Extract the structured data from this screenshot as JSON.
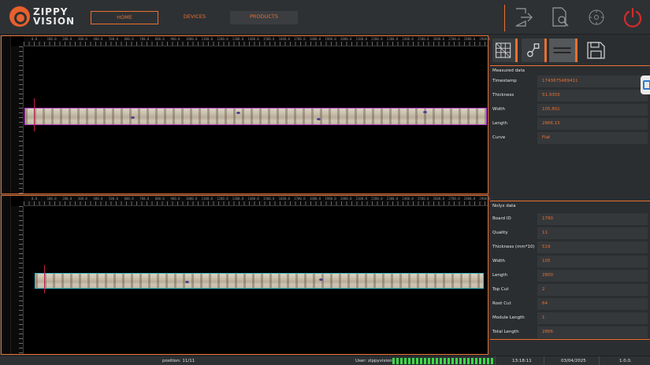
{
  "header": {
    "brand_line1": "ZIPPY",
    "brand_line2": "VISION",
    "nav": {
      "home": "HOME",
      "devices": "DEVICES",
      "products": "PRODUCTS"
    },
    "icons": [
      "exit-icon",
      "report-search-icon",
      "settings-icon",
      "power-icon"
    ],
    "colors": {
      "accent": "#e8702f",
      "power": "#d42b2b"
    }
  },
  "viewer_top": {
    "ruler_labels": [
      "0.0",
      "100.0",
      "200.0",
      "300.0",
      "400.0",
      "500.0",
      "600.0",
      "700.0",
      "800.0",
      "900.0",
      "1000.0",
      "1100.0",
      "1200.0",
      "1300.0",
      "1400.0",
      "1500.0",
      "1600.0",
      "1700.0",
      "1800.0",
      "1900.0",
      "2000.0",
      "2100.0",
      "2200.0",
      "2300.0",
      "2400.0",
      "2500.0",
      "2600.0",
      "2700.0",
      "2800.0",
      "2900.0"
    ]
  },
  "viewer_bottom": {
    "ruler_labels": [
      "0.0",
      "100.0",
      "200.0",
      "300.0",
      "400.0",
      "500.0",
      "600.0",
      "700.0",
      "800.0",
      "900.0",
      "1000.0",
      "1100.0",
      "1200.0",
      "1300.0",
      "1400.0",
      "1500.0",
      "1600.0",
      "1700.0",
      "1800.0",
      "1900.0",
      "2000.0",
      "2100.0",
      "2200.0",
      "2300.0",
      "2400.0",
      "2500.0",
      "2600.0",
      "2700.0",
      "2800.0",
      "2900.0"
    ]
  },
  "measured": {
    "title": "Measured data",
    "rows": [
      {
        "label": "Timestamp",
        "value": "1743675489411"
      },
      {
        "label": "Thickness",
        "value": "51.9355"
      },
      {
        "label": "Width",
        "value": "105.801"
      },
      {
        "label": "Length",
        "value": "2866.15"
      },
      {
        "label": "Curve",
        "value": "Flat"
      }
    ]
  },
  "nolyx": {
    "title": "Nolyx data",
    "rows": [
      {
        "label": "Board ID",
        "value": "1780"
      },
      {
        "label": "Quality",
        "value": "11"
      },
      {
        "label": "Thickness (mm*10)",
        "value": "519"
      },
      {
        "label": "Width",
        "value": "105"
      },
      {
        "label": "Length",
        "value": "2800"
      },
      {
        "label": "Top Cut",
        "value": "2"
      },
      {
        "label": "Root Cut",
        "value": "64"
      },
      {
        "label": "Module Length",
        "value": "1"
      },
      {
        "label": "Total Length",
        "value": "2866"
      }
    ]
  },
  "status": {
    "position": "position: 11/11",
    "user": "User: zippyvision",
    "time": "13:18:11",
    "date": "03/04/2025",
    "version": "1.0.0."
  }
}
